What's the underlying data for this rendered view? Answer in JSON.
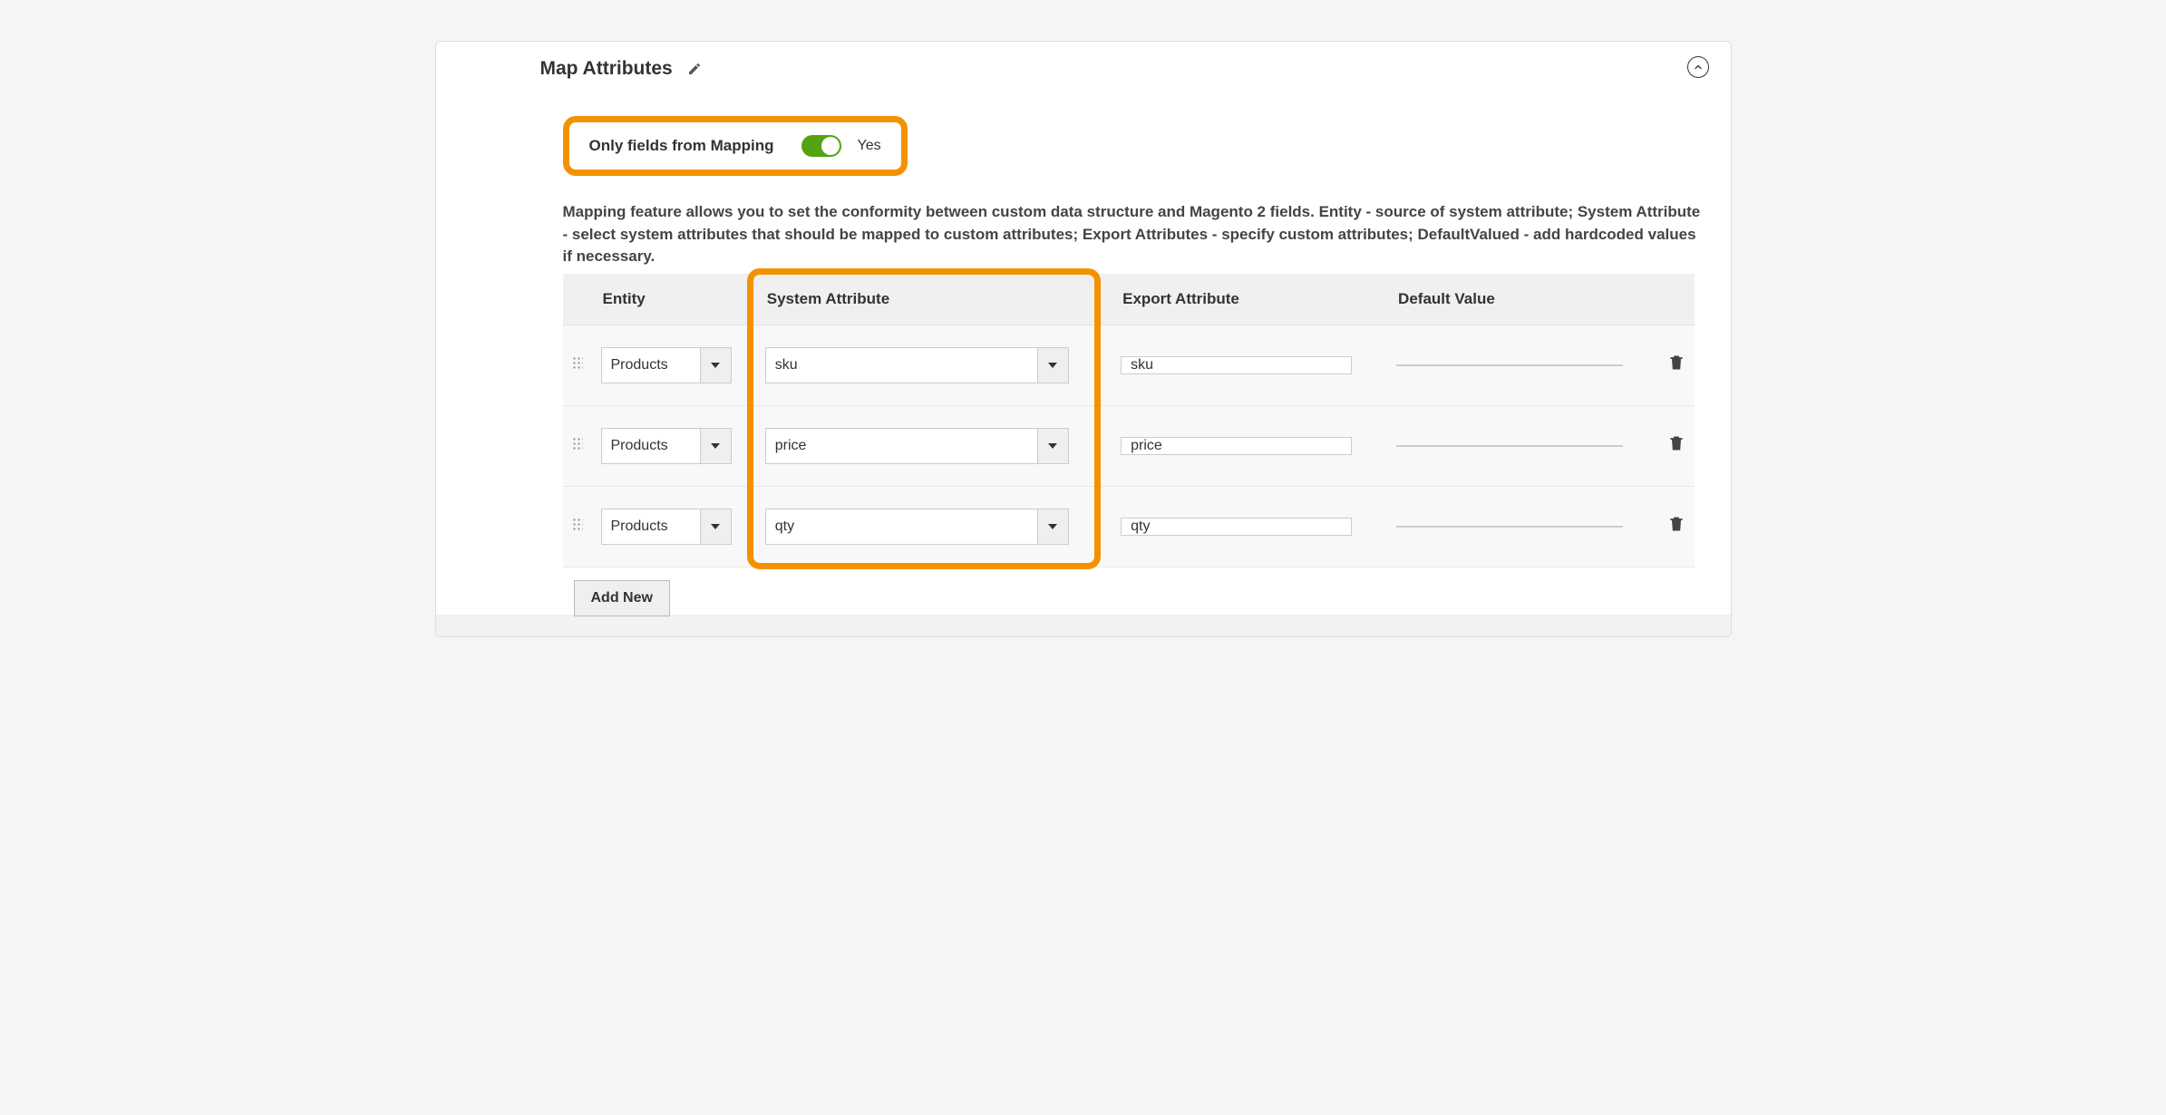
{
  "panel": {
    "title": "Map Attributes"
  },
  "toggle": {
    "label": "Only fields from Mapping",
    "value": "Yes"
  },
  "description": "Mapping feature allows you to set the conformity between custom data structure and Magento 2 fields. Entity - source of system attribute; System Attribute - select system attributes that should be mapped to custom attributes; Export Attributes - specify custom attributes; DefaultValued - add hardcoded values if necessary.",
  "table": {
    "headers": {
      "entity": "Entity",
      "system": "System Attribute",
      "export": "Export Attribute",
      "default": "Default Value"
    },
    "rows": [
      {
        "entity": "Products",
        "system": "sku",
        "export": "sku",
        "default": ""
      },
      {
        "entity": "Products",
        "system": "price",
        "export": "price",
        "default": ""
      },
      {
        "entity": "Products",
        "system": "qty",
        "export": "qty",
        "default": ""
      }
    ]
  },
  "buttons": {
    "add_new": "Add New"
  }
}
